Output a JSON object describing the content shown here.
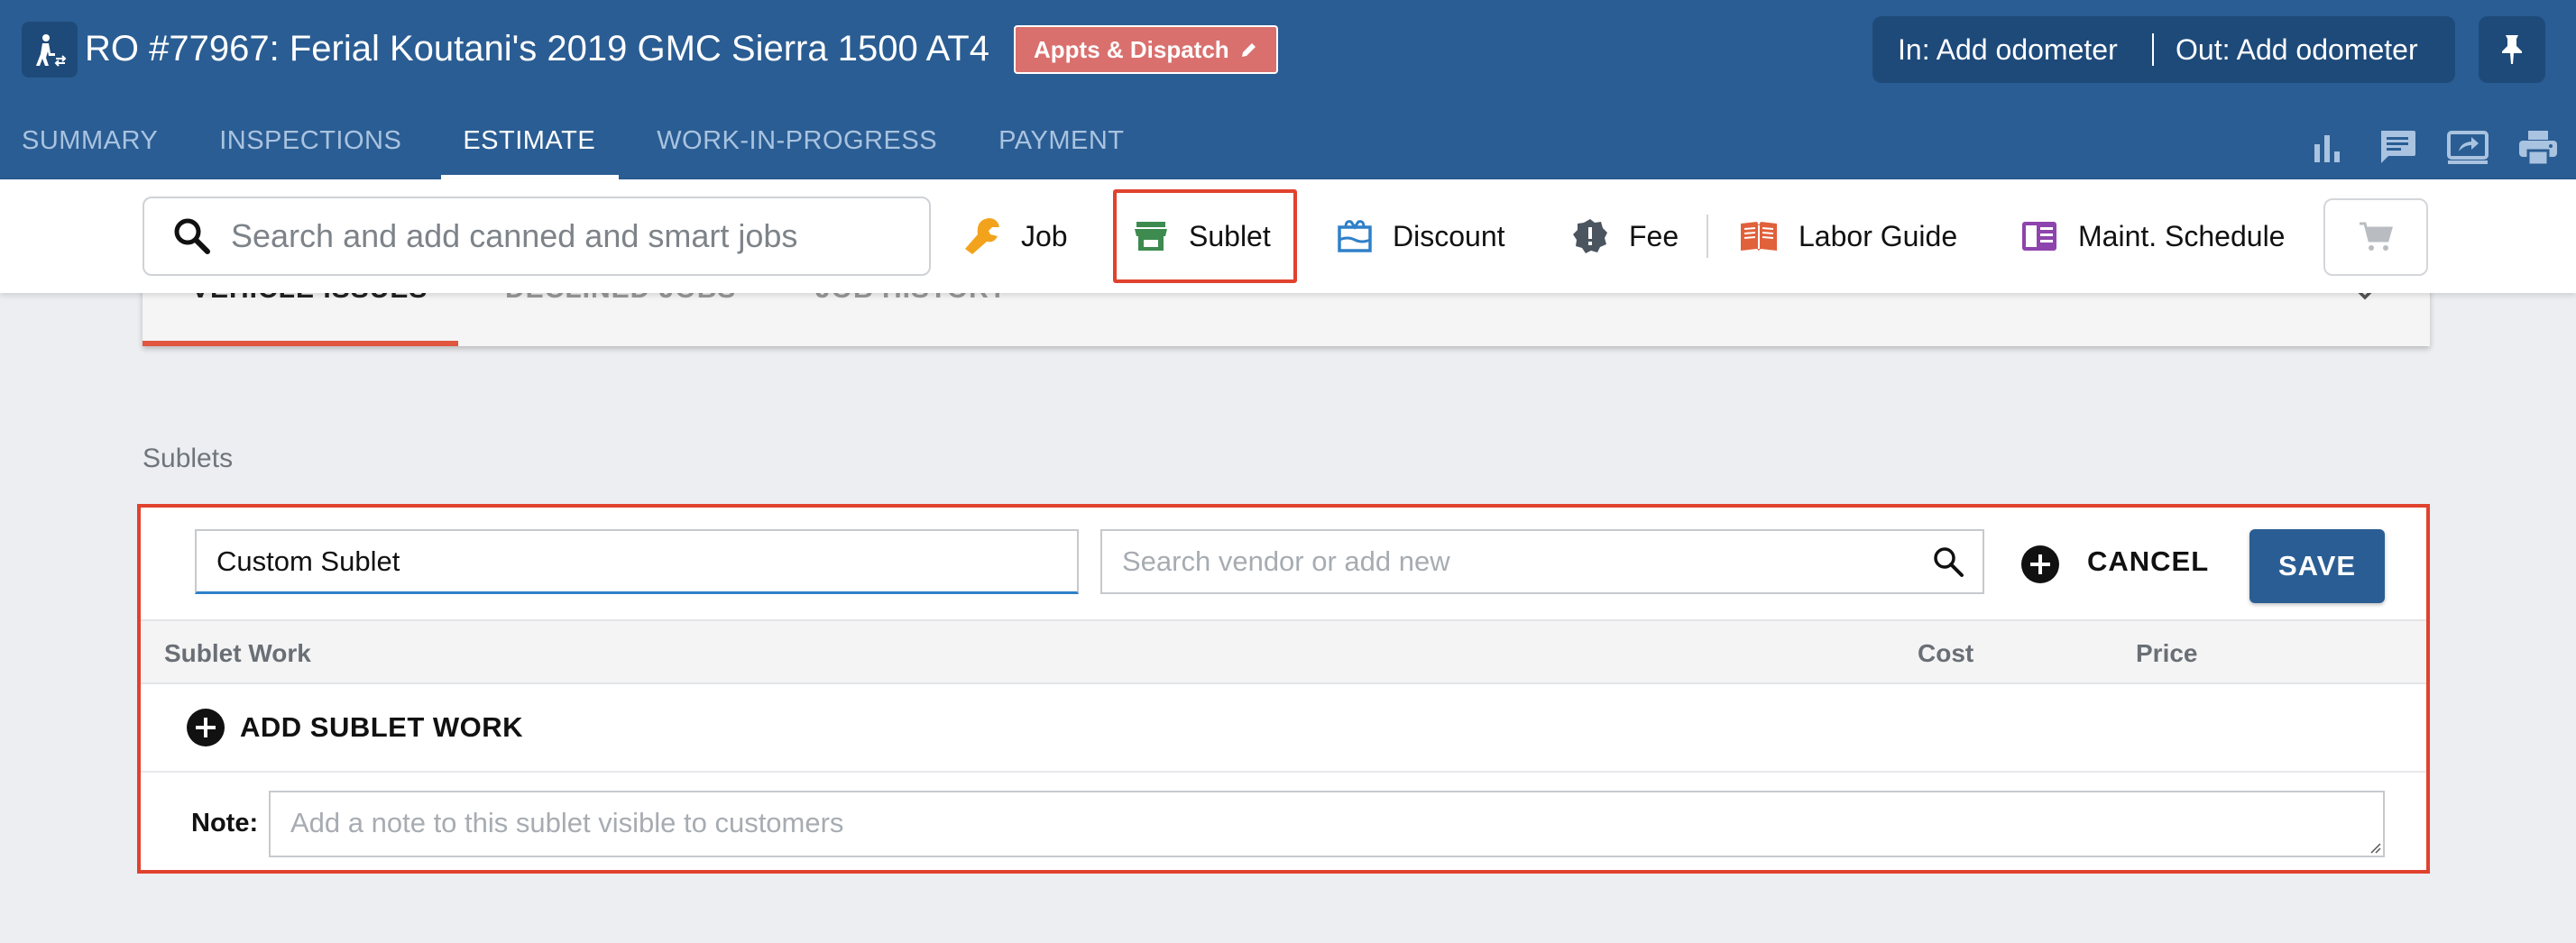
{
  "header": {
    "ro_title": "RO #77967: Ferial Koutani's 2019 GMC Sierra 1500 AT4",
    "appts_badge": "Appts & Dispatch",
    "odometer_in": "In: Add odometer",
    "odometer_out": "Out: Add odometer",
    "tabs": [
      {
        "label": "SUMMARY",
        "active": false
      },
      {
        "label": "INSPECTIONS",
        "active": false
      },
      {
        "label": "ESTIMATE",
        "active": true
      },
      {
        "label": "WORK-IN-PROGRESS",
        "active": false
      },
      {
        "label": "PAYMENT",
        "active": false
      }
    ],
    "tool_icons": [
      "bar-chart-icon",
      "chat-icon",
      "screen-share-icon",
      "printer-icon"
    ]
  },
  "toolbar": {
    "search_placeholder": "Search and add canned and smart jobs",
    "job": "Job",
    "sublet": "Sublet",
    "discount": "Discount",
    "fee": "Fee",
    "labor_guide": "Labor Guide",
    "maint_schedule": "Maint. Schedule"
  },
  "issues_tabs": [
    "VEHICLE ISSUES",
    "DECLINED JOBS",
    "JOB HISTORY"
  ],
  "sublets": {
    "section_label": "Sublets",
    "name_value": "Custom Sublet",
    "vendor_placeholder": "Search vendor or add new",
    "cancel": "CANCEL",
    "save": "SAVE",
    "columns": {
      "work": "Sublet Work",
      "cost": "Cost",
      "price": "Price"
    },
    "add_work": "ADD SUBLET WORK",
    "note_label": "Note:",
    "note_placeholder": "Add a note to this sublet visible to customers"
  },
  "colors": {
    "header_bg": "#2a5d93",
    "highlight": "#e0422e",
    "save_bg": "#2a5d93",
    "badge_bg": "#d9706e"
  }
}
